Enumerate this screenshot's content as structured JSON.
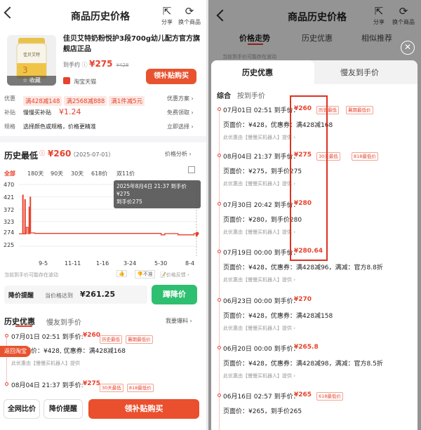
{
  "left": {
    "header": {
      "title": "商品历史价格",
      "share": "分享",
      "switch": "换个商品"
    },
    "product": {
      "name": "佳贝艾特奶粉悦护3段700g幼儿配方官方旗舰店正品",
      "price_label": "到手约",
      "price": "¥275",
      "orig_price": "¥428",
      "shop": "淘宝天猫",
      "fav": "收藏",
      "buy_btn": "领补贴购买",
      "image_brand": "佳贝艾特 悦护"
    },
    "info": {
      "coupon_label": "优惠",
      "coupons": [
        "满428减148",
        "满2568减888",
        "满1件减5元"
      ],
      "coupon_right": "优惠方案",
      "subsidy_label": "补贴",
      "subsidy_text": "慢慢买补贴",
      "subsidy_amount": "¥1.24",
      "subsidy_right": "免费领取",
      "spec_label": "规格",
      "spec_text": "选择颜色或规格，价格更精准",
      "spec_right": "立即选择"
    },
    "history": {
      "low_label": "历史最低",
      "low_price": "¥260",
      "low_date": "（2025-07-01）",
      "analysis": "价格分析",
      "ranges": [
        "全部",
        "180天",
        "90天",
        "30天",
        "618价",
        "双11价"
      ],
      "tooltip": "2025年8月4日 21:37 到手价¥275",
      "tooltip_line2": "到手价275",
      "disclaimer": "当前到手价可能存在波动",
      "like": "👍",
      "dislike": "不准",
      "feedback": "价格反馈"
    },
    "chart_data": {
      "type": "line",
      "y_ticks": [
        "470",
        "421",
        "372",
        "323",
        "274",
        "225"
      ],
      "x_ticks": [
        "9-5",
        "11-11",
        "1-16",
        "3-24",
        "5-30",
        "8-4"
      ],
      "ylim": [
        225,
        470
      ],
      "series": [
        {
          "x": [
            0,
            6,
            7,
            8,
            10,
            11,
            12,
            13,
            14,
            16,
            17,
            19,
            20,
            21,
            22,
            30,
            60,
            120,
            180,
            240,
            262,
            268,
            275,
            290,
            300,
            330,
            334,
            336
          ],
          "y": [
            274,
            274,
            428,
            274,
            274,
            410,
            274,
            275,
            300,
            300,
            275,
            380,
            275,
            420,
            278,
            276,
            276,
            276,
            276,
            276,
            276,
            270,
            275,
            275,
            270,
            275,
            265,
            275
          ]
        }
      ],
      "x_range": [
        0,
        336
      ]
    },
    "drop": {
      "label": "降价提醒",
      "text": "当价格达到",
      "price": "¥261.25",
      "btn": "蹲降价"
    },
    "tabs": {
      "active": "历史优惠",
      "other": "慢友到手价",
      "more": "我要爆料"
    },
    "records": [
      {
        "time": "07月01日 02:51 到手价:",
        "price": "¥260",
        "tags": [
          "历史最低",
          "暑期最低价"
        ],
        "detail": "页面价：¥428, 优惠券：满428减168",
        "source": "此优惠由【慢慢买机器人】提供"
      },
      {
        "time": "08月04日 21:37 到手价:",
        "price": "¥275",
        "tags": [
          "30天最低",
          "818最低价"
        ],
        "detail": "",
        "source": ""
      }
    ],
    "float_back": "返回淘宝",
    "bottom": {
      "compare": "全网比价",
      "remind": "降价提醒",
      "buy": "领补贴购买"
    }
  },
  "right": {
    "header": {
      "title": "商品历史价格",
      "share": "分享",
      "switch": "换个商品"
    },
    "tabs": [
      "价格走势",
      "历史优惠",
      "相似推荐"
    ],
    "sheet_tabs": {
      "active": "历史优惠",
      "other": "慢友到手价"
    },
    "sub_tabs": {
      "active": "综合",
      "other": "按到手价"
    },
    "behind_text": "当前到手价可能存在波动",
    "records": [
      {
        "time": "07月01日 02:51 到手价：",
        "price": "¥260",
        "tags": [
          "历史最低",
          "暑期最低价"
        ],
        "detail": "页面价：¥428，优惠券：满428减168",
        "source": "此优惠由【慢慢买机器人】提供"
      },
      {
        "time": "08月04日 21:37 到手价：",
        "price": "¥275",
        "tags": [
          "30天最低",
          "818最低价"
        ],
        "detail": "页面价：¥275，到手价275",
        "source": "此优惠由【慢慢买机器人】提供"
      },
      {
        "time": "07月30日 20:42 到手价：",
        "price": "¥280",
        "tags": [],
        "detail": "页面价：¥280，到手价280",
        "source": "此优惠由【慢慢买机器人】提供"
      },
      {
        "time": "07月19日 00:00 到手价：",
        "price": "¥280.64",
        "tags": [],
        "detail": "页面价：¥428，优惠券：满428减96，满减：官方8.8折",
        "source": "此优惠由【慢慢买机器人】提供"
      },
      {
        "time": "06月23日 00:00 到手价：",
        "price": "¥270",
        "tags": [],
        "detail": "页面价：¥428，优惠券：满428减158",
        "source": "此优惠由【慢慢买机器人】提供"
      },
      {
        "time": "06月20日 00:00 到手价：",
        "price": "¥265.8",
        "tags": [],
        "detail": "页面价：¥428，优惠券：满428减98，满减：官方8.5折",
        "source": "此优惠由【慢慢买机器人】提供"
      },
      {
        "time": "06月16日 02:57 到手价：",
        "price": "¥265",
        "tags": [
          "618最低价"
        ],
        "detail": "页面价：¥265，到手价265",
        "source": ""
      }
    ],
    "colors": {
      "accent": "#e8412c",
      "highlight_box": "#e03020",
      "green": "#2fbf71"
    }
  }
}
